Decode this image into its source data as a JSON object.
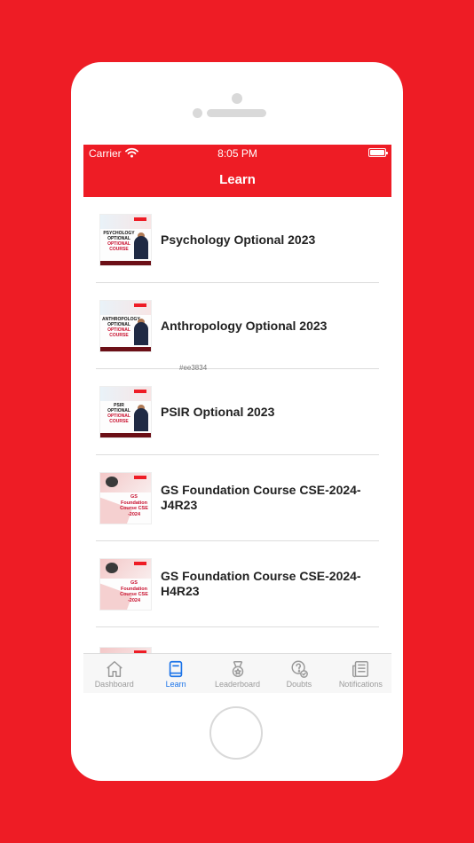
{
  "status_bar": {
    "carrier": "Carrier",
    "time": "8:05 PM"
  },
  "header": {
    "title": "Learn"
  },
  "annotation": "#ee3834",
  "courses": [
    {
      "title": "Psychology Optional 2023",
      "thumb_line1": "PSYCHOLOGY",
      "thumb_line2": "OPTIONAL",
      "thumb_line3": "OPTIONAL COURSE"
    },
    {
      "title": "Anthropology Optional 2023",
      "thumb_line1": "ANTHROPOLOGY",
      "thumb_line2": "OPTIONAL",
      "thumb_line3": "OPTIONAL COURSE"
    },
    {
      "title": "PSIR Optional 2023",
      "thumb_line1": "PSIR",
      "thumb_line2": "OPTIONAL",
      "thumb_line3": "OPTIONAL COURSE"
    },
    {
      "title": "GS Foundation Course CSE-2024-J4R23",
      "thumb_line1": "GS",
      "thumb_line2": "Foundation",
      "thumb_line3": "Course CSE -2024"
    },
    {
      "title": "GS Foundation Course CSE-2024-H4R23",
      "thumb_line1": "GS",
      "thumb_line2": "Foundation",
      "thumb_line3": "Course CSE -2024"
    }
  ],
  "tabs": [
    {
      "label": "Dashboard",
      "icon": "home-icon"
    },
    {
      "label": "Learn",
      "icon": "book-icon",
      "active": true
    },
    {
      "label": "Leaderboard",
      "icon": "medal-icon"
    },
    {
      "label": "Doubts",
      "icon": "question-icon"
    },
    {
      "label": "Notifications",
      "icon": "news-icon"
    }
  ],
  "colors": {
    "brand": "#ee1c25",
    "tab_active": "#1a73e8",
    "tab_inactive": "#9a9a9a"
  }
}
